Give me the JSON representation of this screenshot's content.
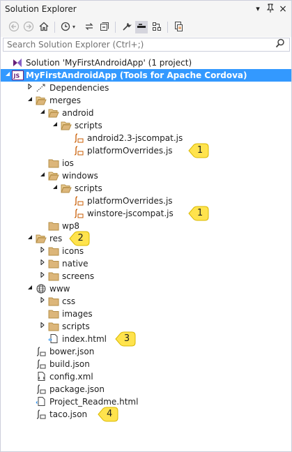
{
  "window": {
    "title": "Solution Explorer",
    "pin_glyph": "▾",
    "autohide_glyph": "⊤",
    "close_glyph": "×"
  },
  "toolbar": {
    "tools": [
      {
        "name": "back-icon",
        "glyph": "◀"
      },
      {
        "name": "forward-icon",
        "glyph": "▶"
      },
      {
        "name": "home-icon",
        "glyph": "⌂"
      },
      {
        "name": "pending-changes-icon",
        "glyph": "◷"
      },
      {
        "name": "sync-icon",
        "glyph": "⇆"
      },
      {
        "name": "collapse-all-icon",
        "glyph": "⊟"
      },
      {
        "name": "show-all-files-icon",
        "glyph": "▣"
      },
      {
        "name": "properties-wrench-icon",
        "glyph": "✎"
      },
      {
        "name": "view-icon",
        "glyph": "▬"
      },
      {
        "name": "class-view-icon",
        "glyph": "⊞"
      },
      {
        "name": "preview-icon",
        "glyph": "⎘"
      }
    ]
  },
  "search": {
    "placeholder": "Search Solution Explorer (Ctrl+;)",
    "value": "",
    "icon": "search-icon"
  },
  "tree": [
    {
      "label": "Solution 'MyFirstAndroidApp' (1 project)",
      "icon": "solution",
      "depth": 0,
      "expander": "none"
    },
    {
      "label": "MyFirstAndroidApp (Tools for Apache Cordova)",
      "icon": "js-project",
      "depth": 0,
      "expander": "open",
      "selected": true
    },
    {
      "label": "Dependencies",
      "icon": "dependencies",
      "depth": 1,
      "expander": "closed"
    },
    {
      "label": "merges",
      "icon": "folder-open",
      "depth": 1,
      "expander": "open"
    },
    {
      "label": "android",
      "icon": "folder-open",
      "depth": 2,
      "expander": "open"
    },
    {
      "label": "scripts",
      "icon": "folder-open",
      "depth": 3,
      "expander": "open"
    },
    {
      "label": "android2.3-jscompat.js",
      "icon": "js-file",
      "depth": 4,
      "expander": "none"
    },
    {
      "label": "platformOverrides.js",
      "icon": "js-file",
      "depth": 4,
      "expander": "none",
      "callout": "1"
    },
    {
      "label": "ios",
      "icon": "folder",
      "depth": 2,
      "expander": "none"
    },
    {
      "label": "windows",
      "icon": "folder-open",
      "depth": 2,
      "expander": "open"
    },
    {
      "label": "scripts",
      "icon": "folder-open",
      "depth": 3,
      "expander": "open"
    },
    {
      "label": "platformOverrides.js",
      "icon": "js-file",
      "depth": 4,
      "expander": "none"
    },
    {
      "label": "winstore-jscompat.js",
      "icon": "js-file",
      "depth": 4,
      "expander": "none",
      "callout": "1"
    },
    {
      "label": "wp8",
      "icon": "folder",
      "depth": 2,
      "expander": "none"
    },
    {
      "label": "res",
      "icon": "folder-open",
      "depth": 1,
      "expander": "open",
      "callout": "2"
    },
    {
      "label": "icons",
      "icon": "folder",
      "depth": 2,
      "expander": "closed"
    },
    {
      "label": "native",
      "icon": "folder",
      "depth": 2,
      "expander": "closed"
    },
    {
      "label": "screens",
      "icon": "folder",
      "depth": 2,
      "expander": "closed"
    },
    {
      "label": "www",
      "icon": "globe",
      "depth": 1,
      "expander": "open"
    },
    {
      "label": "css",
      "icon": "folder",
      "depth": 2,
      "expander": "closed"
    },
    {
      "label": "images",
      "icon": "folder",
      "depth": 2,
      "expander": "none"
    },
    {
      "label": "scripts",
      "icon": "folder",
      "depth": 2,
      "expander": "closed"
    },
    {
      "label": "index.html",
      "icon": "html-file",
      "depth": 2,
      "expander": "none",
      "callout": "3"
    },
    {
      "label": "bower.json",
      "icon": "json-file",
      "depth": 1,
      "expander": "none"
    },
    {
      "label": "build.json",
      "icon": "json-file",
      "depth": 1,
      "expander": "none"
    },
    {
      "label": "config.xml",
      "icon": "xml-file",
      "depth": 1,
      "expander": "none"
    },
    {
      "label": "package.json",
      "icon": "json-file",
      "depth": 1,
      "expander": "none"
    },
    {
      "label": "Project_Readme.html",
      "icon": "html-doc",
      "depth": 1,
      "expander": "none"
    },
    {
      "label": "taco.json",
      "icon": "json-file",
      "depth": 1,
      "expander": "none",
      "callout": "4"
    }
  ],
  "colors": {
    "selection": "#3399ff",
    "folder": "#dcb67a",
    "js_orange": "#c95b00",
    "callout_fill": "#ffe34d",
    "callout_stroke": "#d9b800",
    "toolbar_bg": "#f5f5f5"
  }
}
